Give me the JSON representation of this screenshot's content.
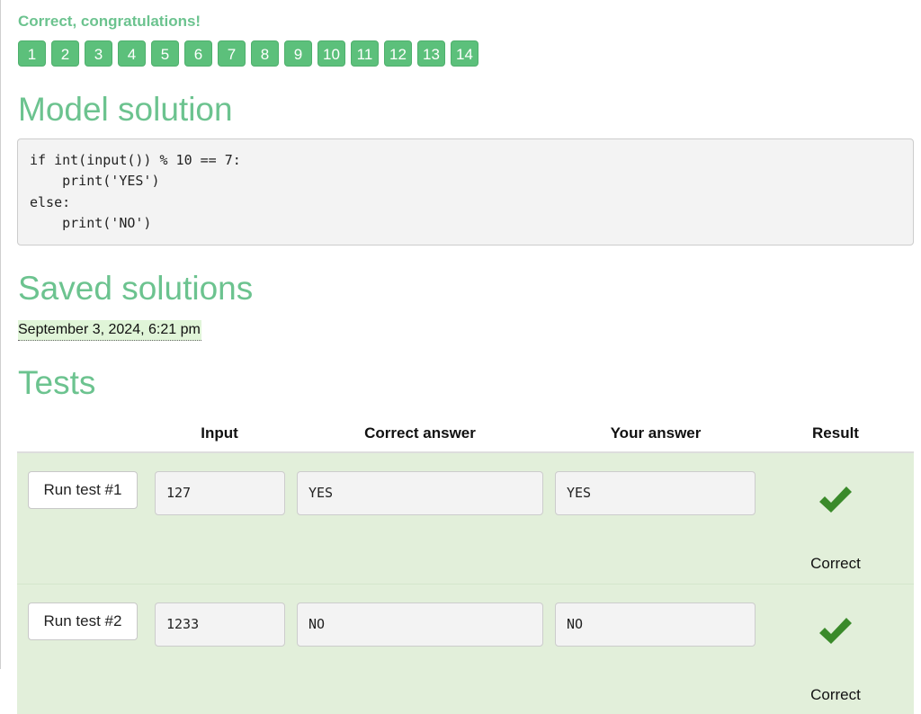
{
  "status": {
    "message": "Correct, congratulations!"
  },
  "steps": [
    "1",
    "2",
    "3",
    "4",
    "5",
    "6",
    "7",
    "8",
    "9",
    "10",
    "11",
    "12",
    "13",
    "14"
  ],
  "model_solution": {
    "heading": "Model solution",
    "code": "if int(input()) % 10 == 7:\n    print('YES')\nelse:\n    print('NO')"
  },
  "saved_solutions": {
    "heading": "Saved solutions",
    "entries": [
      "September 3, 2024, 6:21 pm"
    ]
  },
  "tests": {
    "heading": "Tests",
    "columns": {
      "input": "Input",
      "correct_answer": "Correct answer",
      "your_answer": "Your answer",
      "result": "Result"
    },
    "rows": [
      {
        "run_label": "Run test #1",
        "input": "127",
        "correct_answer": "YES",
        "your_answer": "YES",
        "result": "Correct"
      },
      {
        "run_label": "Run test #2",
        "input": "1233",
        "correct_answer": "NO",
        "your_answer": "NO",
        "result": "Correct"
      }
    ]
  },
  "colors": {
    "accent_green": "#6cc38f",
    "badge_green": "#5cc07b",
    "row_background": "#e2efda",
    "check_green": "#3a8a2a",
    "saved_highlight": "#e0f5d8"
  }
}
